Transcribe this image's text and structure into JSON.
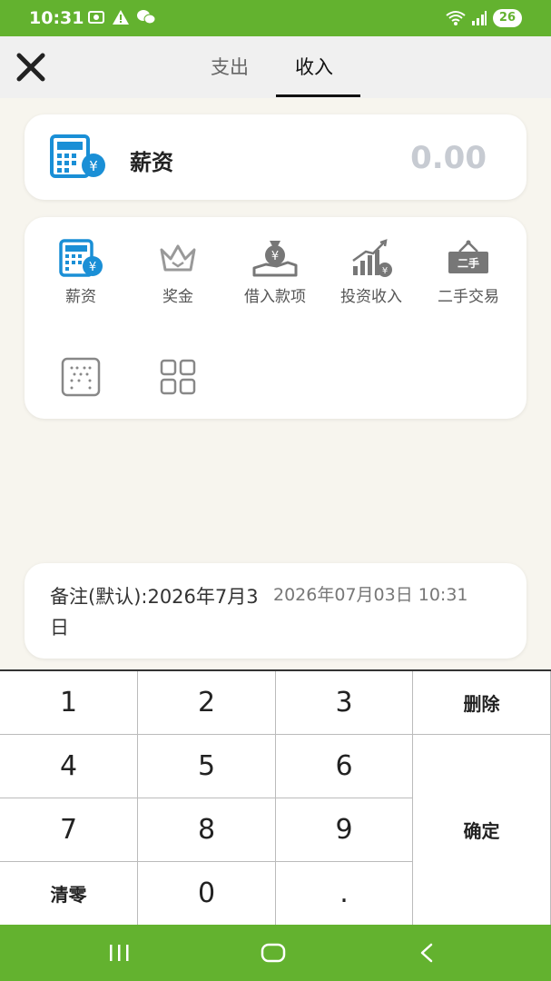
{
  "status_bar": {
    "time": "10:31",
    "battery": "26"
  },
  "header": {
    "tabs": [
      {
        "label": "支出",
        "active": false
      },
      {
        "label": "收入",
        "active": true
      }
    ]
  },
  "amount_card": {
    "label": "薪资",
    "value": "0.00"
  },
  "categories": [
    {
      "label": "薪资",
      "icon": "calculator-icon"
    },
    {
      "label": "奖金",
      "icon": "crown-icon"
    },
    {
      "label": "借入款项",
      "icon": "money-bag-hand-icon"
    },
    {
      "label": "投资收入",
      "icon": "bar-chart-icon"
    },
    {
      "label": "二手交易",
      "icon": "sign-board-icon"
    },
    {
      "label": "",
      "icon": "dotted-grid-icon"
    },
    {
      "label": "",
      "icon": "apps-grid-icon"
    }
  ],
  "memo": {
    "text": "备注(默认):2026年7月3日",
    "datetime": "2026年07月03日 10:31"
  },
  "keypad": {
    "k1": "1",
    "k2": "2",
    "k3": "3",
    "delete": "删除",
    "k4": "4",
    "k5": "5",
    "k6": "6",
    "k7": "7",
    "k8": "8",
    "k9": "9",
    "confirm": "确定",
    "clear": "清零",
    "k0": "0",
    "dot": "."
  },
  "colors": {
    "accent": "#63b22f",
    "icon_blue": "#1a8fd6",
    "amount_placeholder": "#c7cbd2"
  }
}
